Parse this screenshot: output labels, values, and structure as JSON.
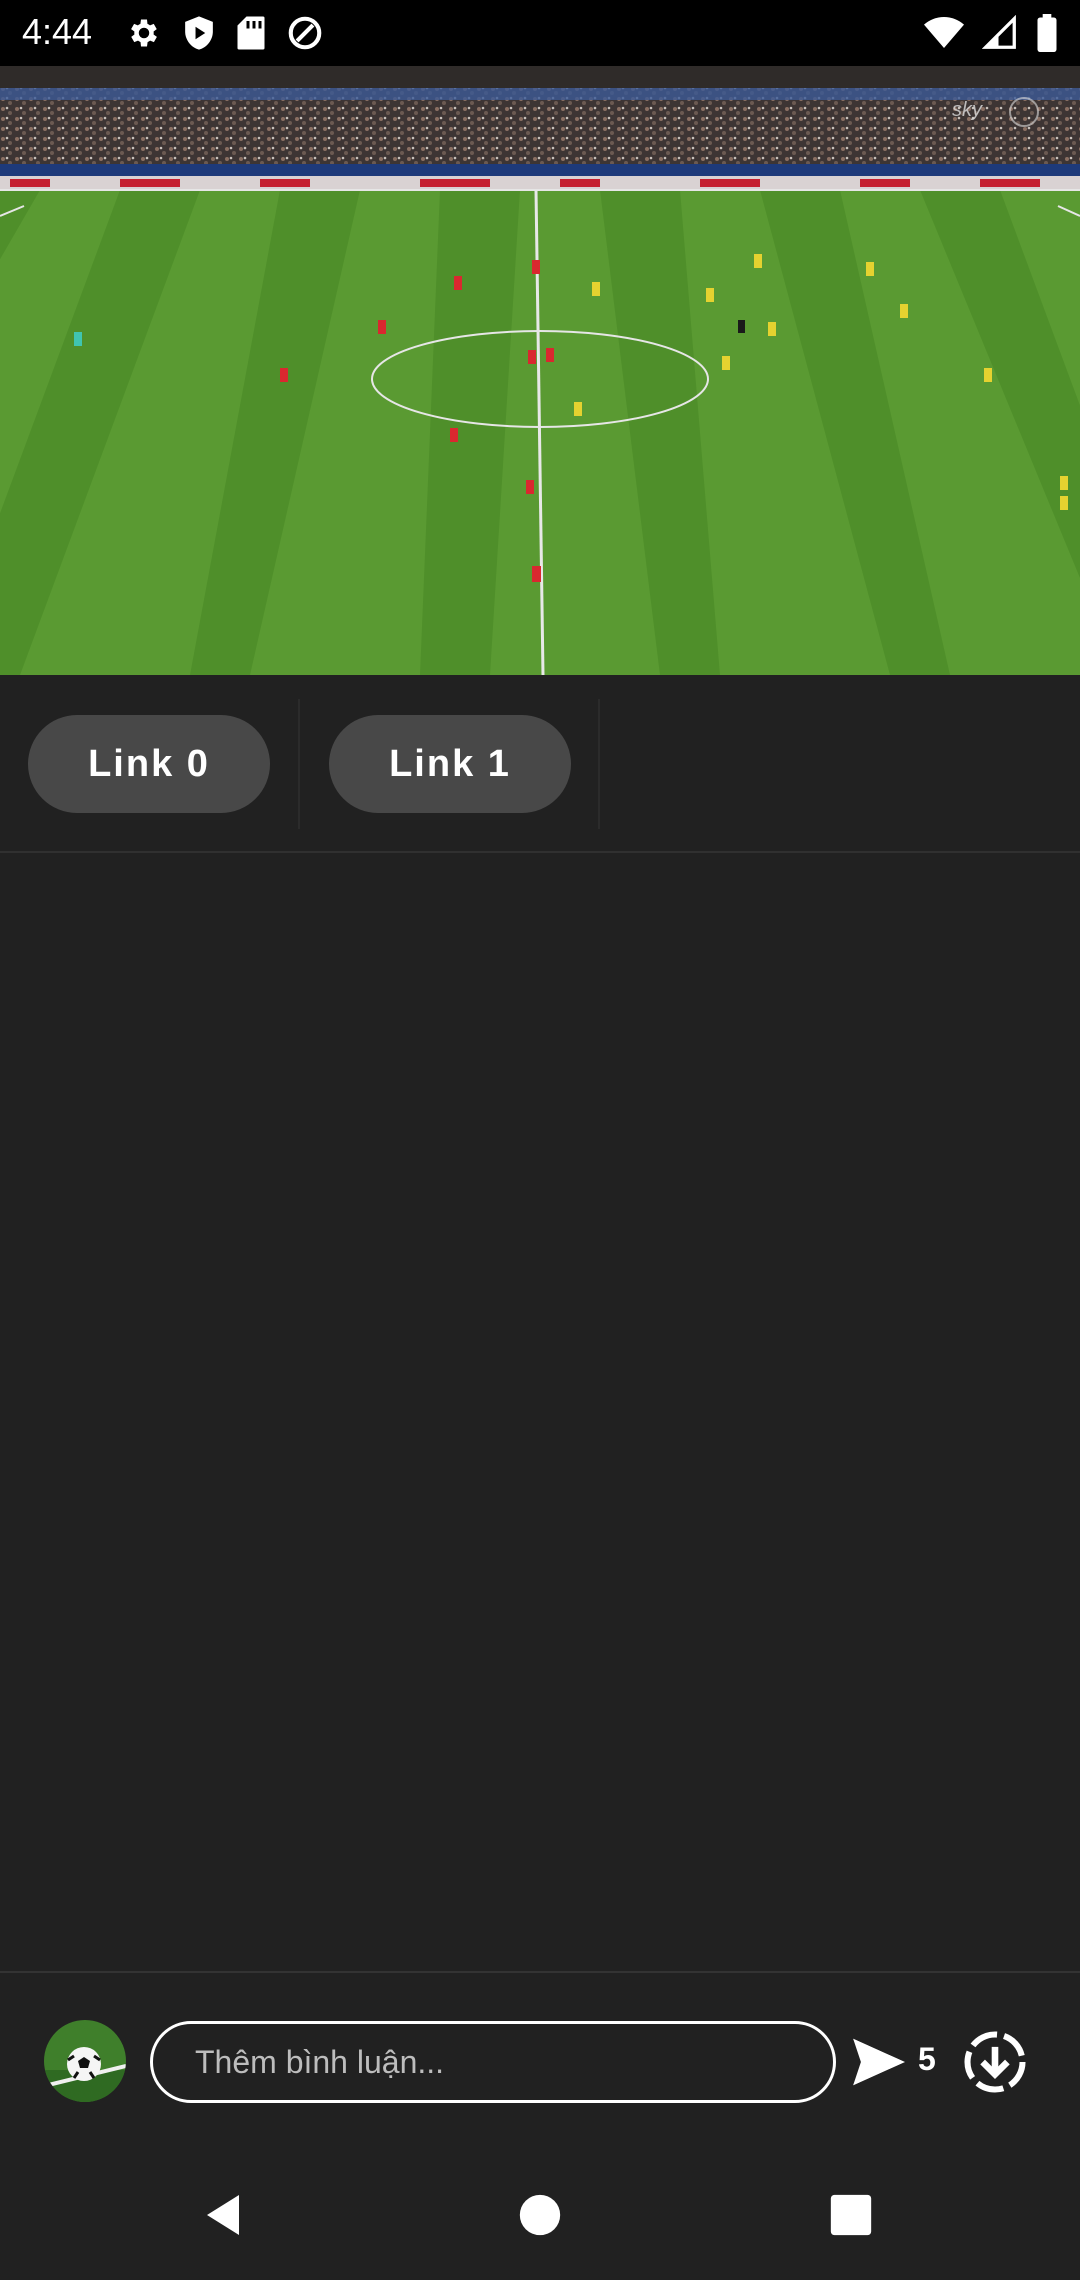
{
  "status_bar": {
    "time": "4:44",
    "left_icons": [
      "settings-icon",
      "shield-play-icon",
      "sd-card-icon",
      "data-saver-icon"
    ],
    "right_icons": [
      "wifi-icon",
      "signal-icon",
      "battery-icon"
    ]
  },
  "video": {
    "description_icon": "soccer-match-video"
  },
  "links": [
    {
      "label": "Link 0"
    },
    {
      "label": "Link 1"
    }
  ],
  "comment_bar": {
    "placeholder": "Thêm bình luận...",
    "send_count": "5"
  },
  "nav_bar": {
    "buttons": [
      "back-icon",
      "home-icon",
      "recents-icon"
    ]
  },
  "colors": {
    "background": "#212121",
    "status_bar": "#000000",
    "link_button": "#484848",
    "pitch_green": "#4f8f2a"
  }
}
